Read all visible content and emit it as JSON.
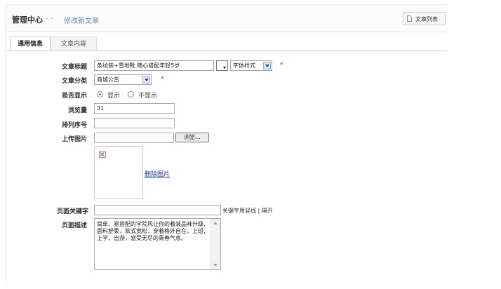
{
  "header": {
    "title": "管理中心",
    "separator": "- -",
    "subtitle": "修改新文章",
    "list_button_label": "文章列表"
  },
  "tabs": [
    {
      "label": "通用信息",
      "active": true
    },
    {
      "label": "文章内容",
      "active": false
    }
  ],
  "form": {
    "title_label": "文章标题",
    "title_value": "条纹装+雪地靴 随心搭配年轻5岁",
    "font_style_select": "字体样式",
    "required_mark": "*",
    "category_label": "文章分类",
    "category_value": "商城公告",
    "show_label": "是否显示",
    "show_options": [
      "显示",
      "不显示"
    ],
    "show_selected": "显示",
    "views_label": "浏览量",
    "views_value": "31",
    "sort_label": "排列序号",
    "sort_value": "",
    "upload_label": "上传图片",
    "upload_value": "",
    "browse_button": "浏览...",
    "delete_image_link": "删除图片",
    "keywords_label": "页面关键字",
    "keywords_value": "",
    "keywords_hint": "关键字用竖线 | 隔开",
    "description_label": "页面描述",
    "description_value": "简单、易搭配的学院风让你的着装品味升级、面料舒柔，款式宽松，穿着格外自在，上班、上学、出游，感受无尽的青春气息。"
  },
  "colors": {
    "subtitle": "#6a86b3",
    "required": "#e02020",
    "link": "#1a3a8a"
  }
}
